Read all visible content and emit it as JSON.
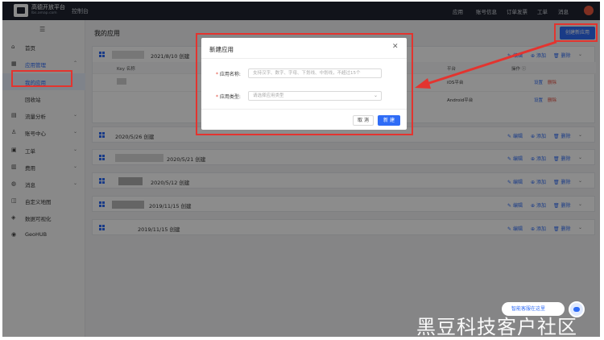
{
  "header": {
    "brand": "高德开放平台",
    "brand_sub": "lbs.amap.com",
    "console": "控制台",
    "nav": [
      "应用",
      "账号信息",
      "订单发票",
      "工单",
      "消息"
    ]
  },
  "sidebar": {
    "items": [
      {
        "label": "首页",
        "icon": "home-icon",
        "has_chevron": false
      },
      {
        "label": "应用管理",
        "icon": "grid-icon",
        "has_chevron": true
      },
      {
        "label": "我的应用",
        "icon": "",
        "has_chevron": false,
        "active": true
      },
      {
        "label": "回收站",
        "icon": "",
        "has_chevron": false
      },
      {
        "label": "流量分析",
        "icon": "chart-icon",
        "has_chevron": true
      },
      {
        "label": "账号中心",
        "icon": "user-icon",
        "has_chevron": true
      },
      {
        "label": "工单",
        "icon": "ticket-icon",
        "has_chevron": true
      },
      {
        "label": "费用",
        "icon": "money-icon",
        "has_chevron": true
      },
      {
        "label": "消息",
        "icon": "message-icon",
        "has_chevron": true
      },
      {
        "label": "自定义地图",
        "icon": "map-icon",
        "has_chevron": false
      },
      {
        "label": "数据可视化",
        "icon": "visual-icon",
        "has_chevron": false
      },
      {
        "label": "GeoHUB",
        "icon": "geohub-icon",
        "has_chevron": false
      }
    ]
  },
  "main": {
    "title": "我的应用",
    "create_button": "创建新应用",
    "table_headers": {
      "key": "Key 名称",
      "platform": "平台",
      "ops": "操作 ⓘ"
    },
    "row_links": {
      "settings": "设置",
      "delete": "删除"
    },
    "apps": [
      {
        "date": "2021/8/10 创建",
        "expanded": true,
        "rows": [
          {
            "platform": "iOS平台"
          },
          {
            "platform": "Android平台"
          }
        ]
      },
      {
        "date": "2020/5/26 创建"
      },
      {
        "date": "2020/5/21 创建"
      },
      {
        "date": "2020/5/12 创建"
      },
      {
        "date": "2019/11/15 创建"
      },
      {
        "date": "2019/11/15 创建"
      }
    ],
    "actions": {
      "edit": "编辑",
      "add": "添加",
      "delete": "删除"
    }
  },
  "dialog": {
    "title": "新建应用",
    "fields": [
      {
        "label": "应用名称:",
        "placeholder": "支持汉字、数字、字母、下划线、中划线，不超过15个"
      },
      {
        "label": "应用类型:",
        "placeholder": "请选择应用类型"
      }
    ],
    "cancel": "取 消",
    "ok": "新 建"
  },
  "chat": {
    "label": "智能客服在这里"
  },
  "watermark": "黑豆科技客户社区",
  "colors": {
    "accent": "#2f6cf6",
    "highlight": "#e3342f",
    "header": "#1f2430"
  }
}
